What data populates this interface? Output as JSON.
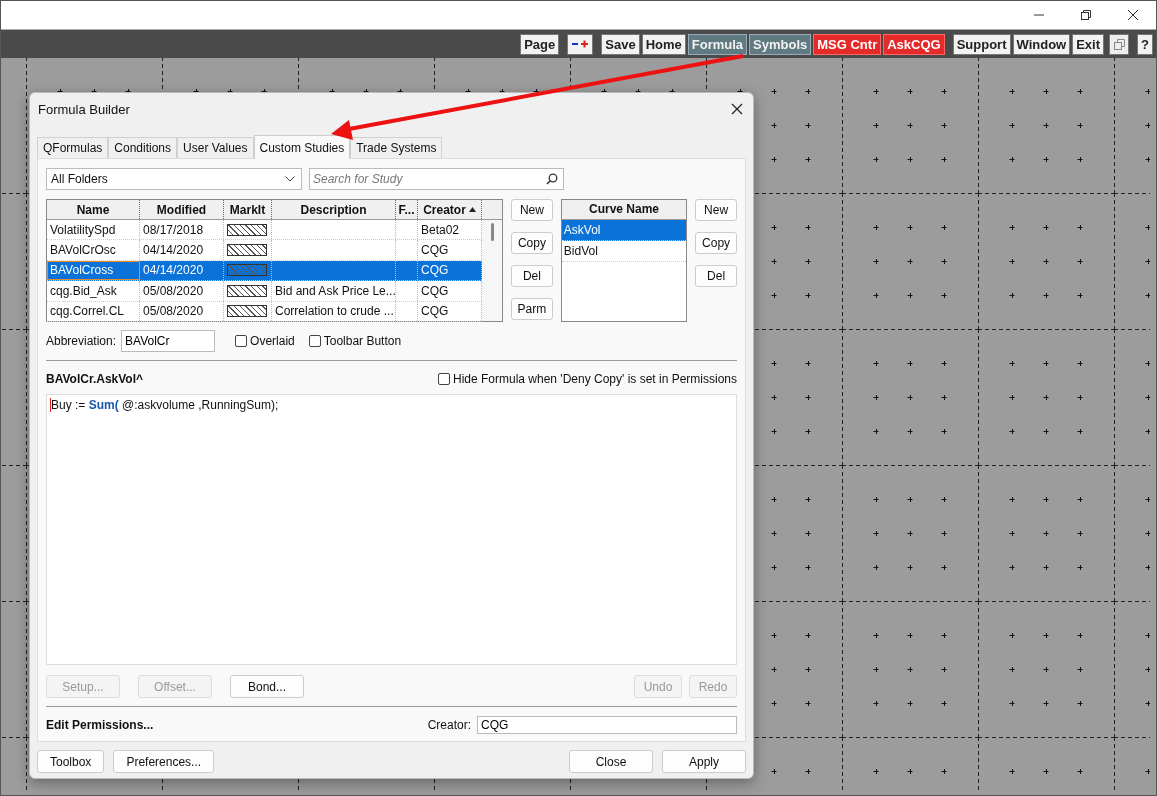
{
  "toolbar": [
    {
      "label": "Page",
      "kind": "plain"
    },
    {
      "kind": "zoom"
    },
    {
      "label": "Save",
      "kind": "plain"
    },
    {
      "label": "Home",
      "kind": "plain"
    },
    {
      "label": "Formula",
      "kind": "active"
    },
    {
      "label": "Symbols",
      "kind": "active"
    },
    {
      "label": "MSG Cntr",
      "kind": "alert"
    },
    {
      "label": "AskCQG",
      "kind": "alert"
    },
    {
      "label": "Support",
      "kind": "plain"
    },
    {
      "label": "Window",
      "kind": "plain"
    },
    {
      "label": "Exit",
      "kind": "plain"
    },
    {
      "kind": "restore"
    },
    {
      "label": "?",
      "kind": "plain"
    }
  ],
  "dialog": {
    "title": "Formula Builder",
    "tabs": [
      {
        "label": "QFormulas",
        "selected": false
      },
      {
        "label": "Conditions",
        "selected": false
      },
      {
        "label": "User Values",
        "selected": false
      },
      {
        "label": "Custom Studies",
        "selected": true
      },
      {
        "label": "Trade Systems",
        "selected": false
      }
    ],
    "folder": "All Folders",
    "search": {
      "placeholder": "Search for Study"
    },
    "studies": {
      "columns": [
        {
          "label": "Name",
          "sorted": false
        },
        {
          "label": "Modified",
          "sorted": false
        },
        {
          "label": "MarkIt",
          "sorted": false
        },
        {
          "label": "Description",
          "sorted": false
        },
        {
          "label": "F...",
          "sorted": false
        },
        {
          "label": "Creator",
          "sorted": true
        }
      ],
      "rows": [
        {
          "name": "VolatilitySpd",
          "modified": "08/17/2018",
          "description": "",
          "creator": "Beta02",
          "selected": false
        },
        {
          "name": "BAVolCrOsc",
          "modified": "04/14/2020",
          "description": "",
          "creator": "CQG",
          "selected": false
        },
        {
          "name": "BAVolCross",
          "modified": "04/14/2020",
          "description": "",
          "creator": "CQG",
          "selected": true
        },
        {
          "name": "cqg.Bid_Ask",
          "modified": "05/08/2020",
          "description": "Bid and Ask Price Le...",
          "creator": "CQG",
          "selected": false
        },
        {
          "name": "cqg.Correl.CL",
          "modified": "05/08/2020",
          "description": "Correlation to crude ...",
          "creator": "CQG",
          "selected": false
        }
      ]
    },
    "study_buttons": [
      "New",
      "Copy",
      "Del",
      "Parm"
    ],
    "curves": {
      "header": "Curve Name",
      "items": [
        {
          "label": "AskVol",
          "selected": true
        },
        {
          "label": "BidVol",
          "selected": false
        }
      ]
    },
    "curve_buttons": [
      "New",
      "Copy",
      "Del"
    ],
    "abbreviation": {
      "label": "Abbreviation:",
      "value": "BAVolCr"
    },
    "options": [
      {
        "label": "Overlaid",
        "checked": false
      },
      {
        "label": "Toolbar Button",
        "checked": false
      }
    ],
    "formula_title": "BAVolCr.AskVol^",
    "hide_formula": {
      "label": "Hide Formula when 'Deny Copy' is set in Permissions",
      "checked": false
    },
    "code": [
      {
        "text": "Buy := ",
        "kind": "plain"
      },
      {
        "text": "Sum(",
        "kind": "function"
      },
      {
        "text": " @:askvolume ,RunningSum);",
        "kind": "plain"
      }
    ],
    "edit_buttons": [
      {
        "label": "Setup...",
        "disabled": true
      },
      {
        "label": "Offset...",
        "disabled": true
      },
      {
        "label": "Bond...",
        "disabled": false
      }
    ],
    "history_buttons": [
      {
        "label": "Undo",
        "disabled": true
      },
      {
        "label": "Redo",
        "disabled": true
      }
    ],
    "permissions": "Edit Permissions...",
    "creator": {
      "label": "Creator:",
      "value": "CQG"
    },
    "footer_left": [
      "Toolbox",
      "Preferences..."
    ],
    "footer_right": [
      "Close",
      "Apply"
    ]
  }
}
